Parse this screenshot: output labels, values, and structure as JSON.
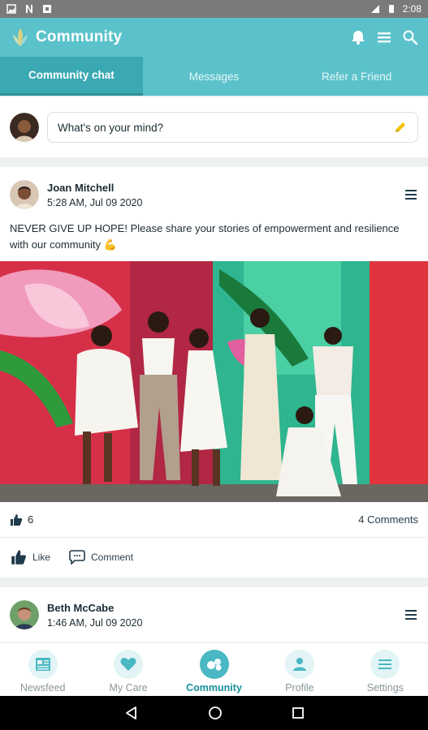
{
  "status_bar": {
    "time": "2:08"
  },
  "app_bar": {
    "title": "Community"
  },
  "tabs": [
    {
      "label": "Community chat",
      "active": true
    },
    {
      "label": "Messages",
      "active": false
    },
    {
      "label": "Refer a Friend",
      "active": false
    }
  ],
  "composer": {
    "placeholder": "What's on your mind?"
  },
  "posts": [
    {
      "author": "Joan Mitchell",
      "time": "5:28 AM, Jul 09 2020",
      "text": "NEVER GIVE UP HOPE! Please share your stories of empowerment and resilience with our community 💪",
      "likes": "6",
      "comments": "4 Comments",
      "like_label": "Like",
      "comment_label": "Comment"
    },
    {
      "author": "Beth McCabe",
      "time": "1:46 AM, Jul 09 2020"
    }
  ],
  "bottom_nav": [
    {
      "label": "Newsfeed",
      "icon": "newspaper-icon"
    },
    {
      "label": "My Care",
      "icon": "heart-icon"
    },
    {
      "label": "Community",
      "icon": "community-icon",
      "active": true
    },
    {
      "label": "Profile",
      "icon": "person-icon"
    },
    {
      "label": "Settings",
      "icon": "menu-icon"
    }
  ],
  "colors": {
    "primary": "#5bc2cb",
    "active_tab": "#3aa9b3",
    "accent_icon": "#f2c200"
  }
}
